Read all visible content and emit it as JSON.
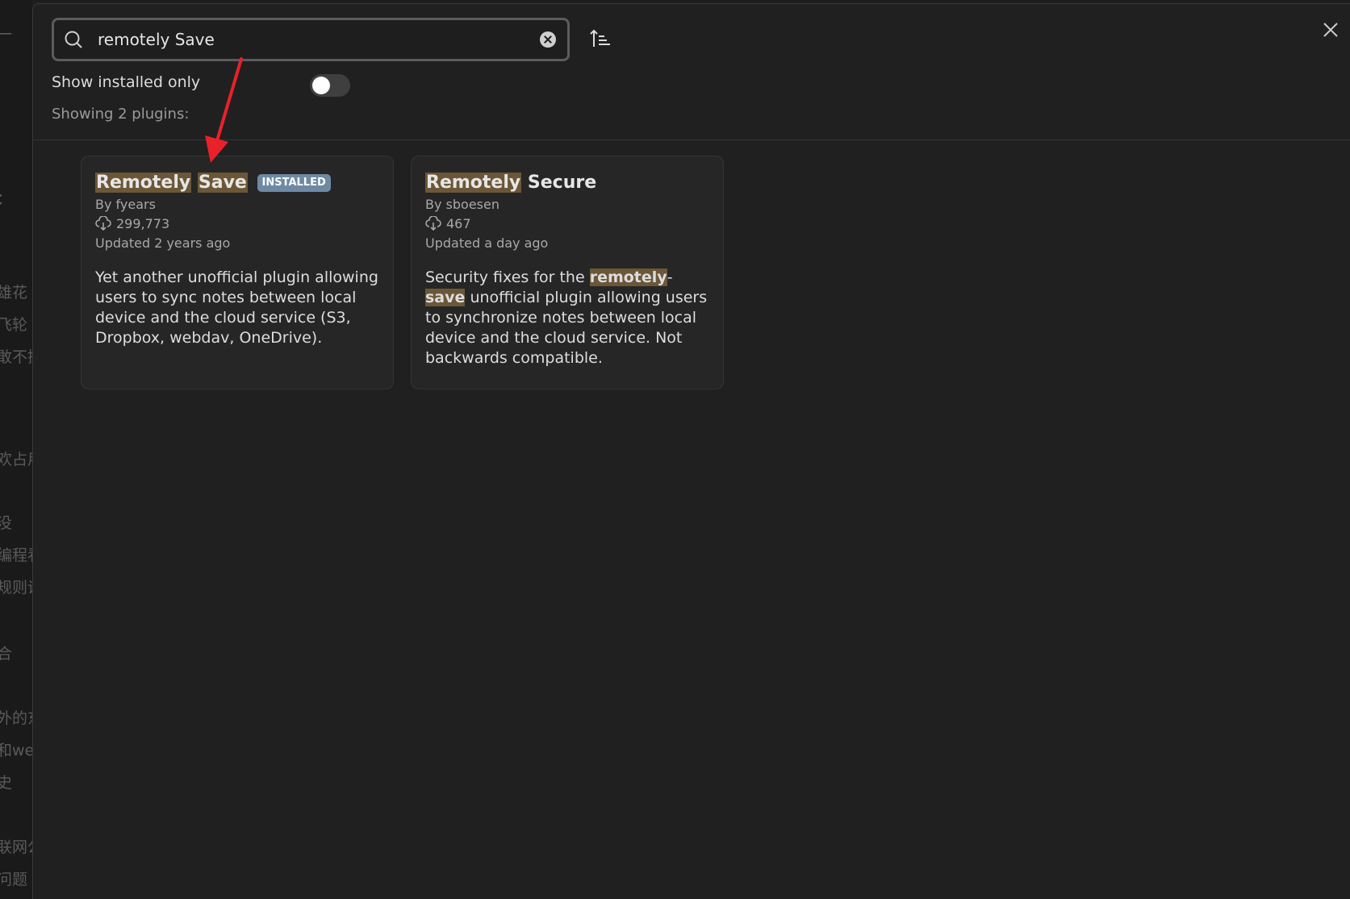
{
  "background": {
    "snippets": [
      "一",
      "：",
      "雄花",
      "飞轮",
      "敢不擅",
      "欢占用",
      "没",
      "编程看",
      "规则说",
      "合",
      "外的东",
      "和web",
      "史",
      "联网公",
      "问题"
    ]
  },
  "search": {
    "value": "remotely Save",
    "icon": "search-icon"
  },
  "filters": {
    "installed_only_label": "Show installed only",
    "installed_only": false,
    "count_text": "Showing 2 plugins:"
  },
  "plugins": [
    {
      "name_part1": "Remotely",
      "name_part2": "Save",
      "badge": "INSTALLED",
      "author": "By fyears",
      "downloads": "299,773",
      "updated": "Updated 2 years ago",
      "description": "Yet another unofficial plugin allowing users to sync notes between local device and the cloud service (S3, Dropbox, webdav, OneDrive)."
    },
    {
      "name_part1": "Remotely",
      "name_part2": "Secure",
      "author": "By sboesen",
      "downloads": "467",
      "updated": "Updated a day ago",
      "desc_prefix": "Security fixes for the ",
      "desc_hl1": "remotely",
      "desc_sep": "-",
      "desc_hl2": "save",
      "desc_rest": " unofficial plugin allowing users to synchronize notes between local device and the cloud service. Not backwards compatible."
    }
  ],
  "colors": {
    "highlight": "#6b5737",
    "badge": "#6e8aa3",
    "annotation_arrow": "#e8212b"
  }
}
